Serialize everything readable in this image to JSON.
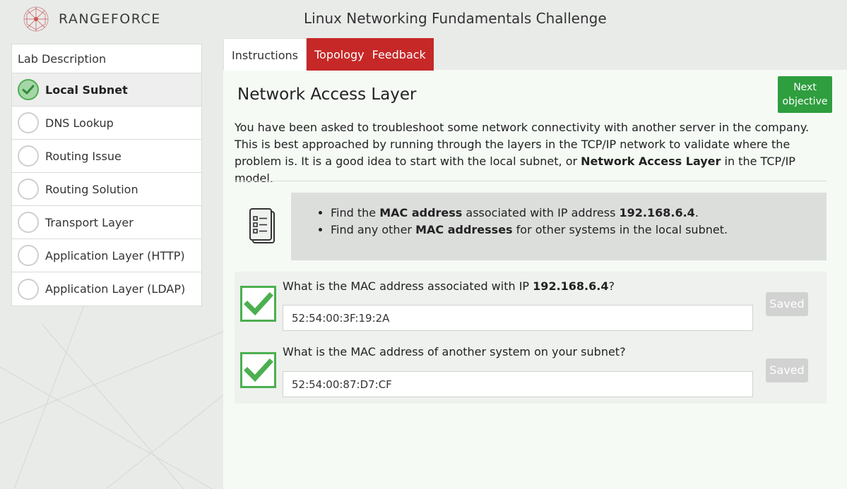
{
  "header": {
    "brand": "RANGEFORCE",
    "title": "Linux Networking Fundamentals Challenge"
  },
  "sidebar": {
    "header": "Lab Description",
    "items": [
      {
        "label": "Local Subnet",
        "status": "complete"
      },
      {
        "label": "DNS Lookup",
        "status": "pending"
      },
      {
        "label": "Routing Issue",
        "status": "pending"
      },
      {
        "label": "Routing Solution",
        "status": "pending"
      },
      {
        "label": "Transport Layer",
        "status": "pending"
      },
      {
        "label": "Application Layer (HTTP)",
        "status": "pending"
      },
      {
        "label": "Application Layer (LDAP)",
        "status": "pending"
      }
    ]
  },
  "tabs": [
    {
      "label": "Instructions",
      "active": true
    },
    {
      "label": "Topology",
      "active": false
    },
    {
      "label": "Feedback",
      "active": false
    }
  ],
  "content": {
    "title": "Network Access Layer",
    "next_button": {
      "line1": "Next",
      "line2": "objective"
    },
    "description": {
      "part1": "You have been asked to troubleshoot some network connectivity with another server in the company. This is best approached by running through the layers in the TCP/IP network to validate where the problem is. It is a good idea to start with the local subnet, or ",
      "bold": "Network Access Layer",
      "part2": " in the TCP/IP model."
    },
    "tasks": [
      {
        "pre": "Find the ",
        "b1": "MAC address",
        "mid": " associated with IP address ",
        "b2": "192.168.6.4",
        "post": "."
      },
      {
        "pre": "Find any other ",
        "b1": "MAC addresses",
        "mid": " for other systems in the local subnet.",
        "b2": "",
        "post": ""
      }
    ],
    "questions": [
      {
        "pre": "What is the MAC address associated with IP ",
        "bold": "192.168.6.4",
        "post": "?",
        "answer": "52:54:00:3F:19:2A",
        "button": "Saved",
        "correct": true
      },
      {
        "pre": "What is the MAC address of another system on your subnet?",
        "bold": "",
        "post": "",
        "answer": "52:54:00:87:D7:CF",
        "button": "Saved",
        "correct": true
      }
    ]
  },
  "colors": {
    "accent_red": "#c62828",
    "success_green": "#2e9e3e",
    "check_green": "#4caf50"
  }
}
